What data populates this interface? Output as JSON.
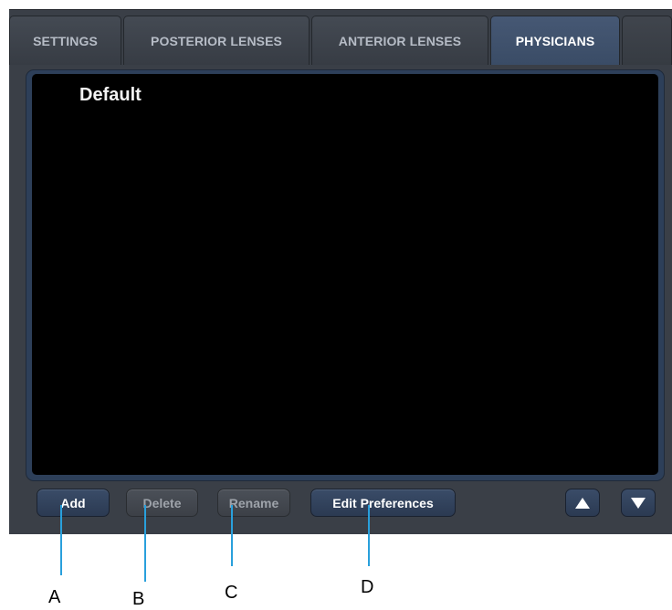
{
  "tabs": [
    {
      "label": "SETTINGS",
      "active": false
    },
    {
      "label": "POSTERIOR LENSES",
      "active": false
    },
    {
      "label": "ANTERIOR LENSES",
      "active": false
    },
    {
      "label": "PHYSICIANS",
      "active": true
    }
  ],
  "physician_list": {
    "items": [
      "Default"
    ]
  },
  "buttons": {
    "add": {
      "label": "Add",
      "enabled": true
    },
    "delete": {
      "label": "Delete",
      "enabled": false
    },
    "rename": {
      "label": "Rename",
      "enabled": false
    },
    "edit_preferences": {
      "label": "Edit Preferences",
      "enabled": true
    },
    "move_up": {
      "icon": "triangle-up-icon"
    },
    "move_down": {
      "icon": "triangle-down-icon"
    }
  },
  "callouts": [
    "A",
    "B",
    "C",
    "D"
  ],
  "colors": {
    "panel": "#3a3f47",
    "active_tab": "#3a4c66",
    "list_frame": "#2d3f59",
    "list_bg": "#000000",
    "callout_line": "#29a0dc"
  }
}
